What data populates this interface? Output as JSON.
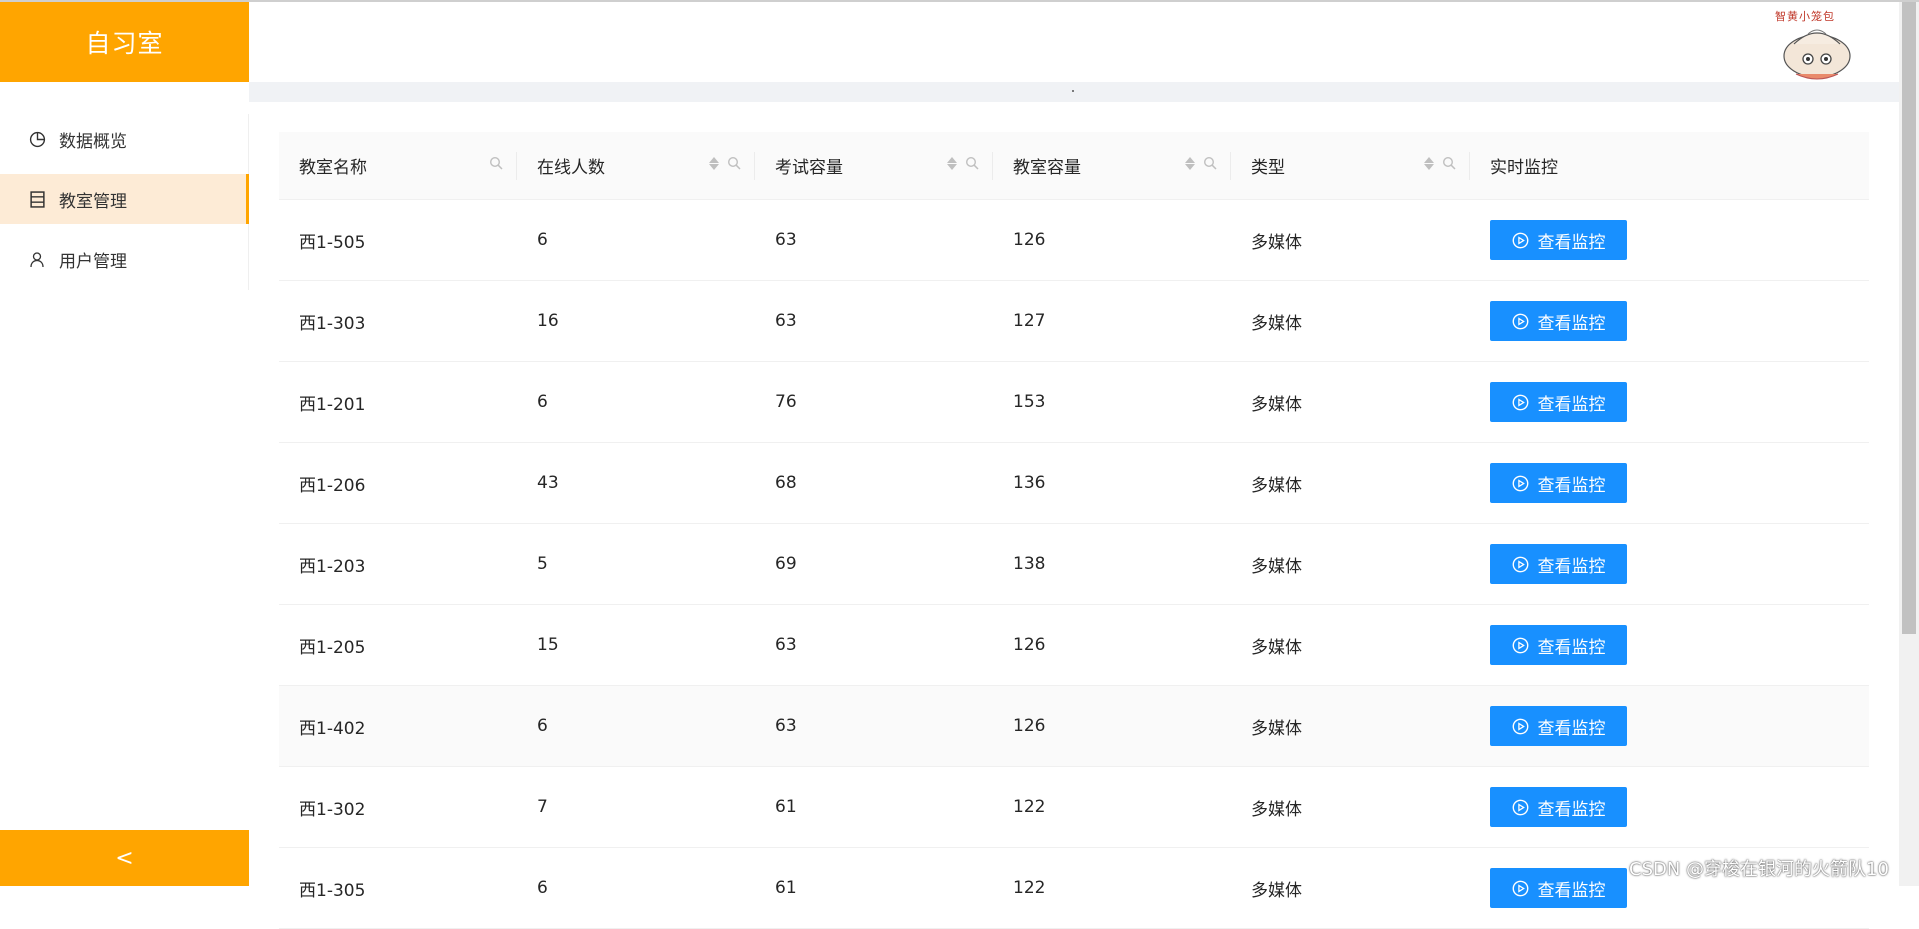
{
  "sidebar": {
    "logo": "自习室",
    "items": [
      {
        "label": "数据概览",
        "icon": "pie-chart-icon",
        "active": false
      },
      {
        "label": "教室管理",
        "icon": "list-icon",
        "active": true
      },
      {
        "label": "用户管理",
        "icon": "user-icon",
        "active": false
      }
    ],
    "collapse_label": "<"
  },
  "header": {
    "avatar_text": "智黄小笼包"
  },
  "colors": {
    "accent": "#ffa500",
    "primary": "#1890ff",
    "active_bg": "#fdebd6"
  },
  "table": {
    "columns": [
      "教室名称",
      "在线人数",
      "考试容量",
      "教室容量",
      "类型",
      "实时监控"
    ],
    "button_label": "查看监控",
    "rows": [
      {
        "name": "西1-505",
        "online": "6",
        "exam_cap": "63",
        "room_cap": "126",
        "type": "多媒体"
      },
      {
        "name": "西1-303",
        "online": "16",
        "exam_cap": "63",
        "room_cap": "127",
        "type": "多媒体"
      },
      {
        "name": "西1-201",
        "online": "6",
        "exam_cap": "76",
        "room_cap": "153",
        "type": "多媒体"
      },
      {
        "name": "西1-206",
        "online": "43",
        "exam_cap": "68",
        "room_cap": "136",
        "type": "多媒体"
      },
      {
        "name": "西1-203",
        "online": "5",
        "exam_cap": "69",
        "room_cap": "138",
        "type": "多媒体"
      },
      {
        "name": "西1-205",
        "online": "15",
        "exam_cap": "63",
        "room_cap": "126",
        "type": "多媒体"
      },
      {
        "name": "西1-402",
        "online": "6",
        "exam_cap": "63",
        "room_cap": "126",
        "type": "多媒体"
      },
      {
        "name": "西1-302",
        "online": "7",
        "exam_cap": "61",
        "room_cap": "122",
        "type": "多媒体"
      },
      {
        "name": "西1-305",
        "online": "6",
        "exam_cap": "61",
        "room_cap": "122",
        "type": "多媒体"
      }
    ]
  },
  "watermark": "CSDN @穿梭在银河的火箭队10"
}
